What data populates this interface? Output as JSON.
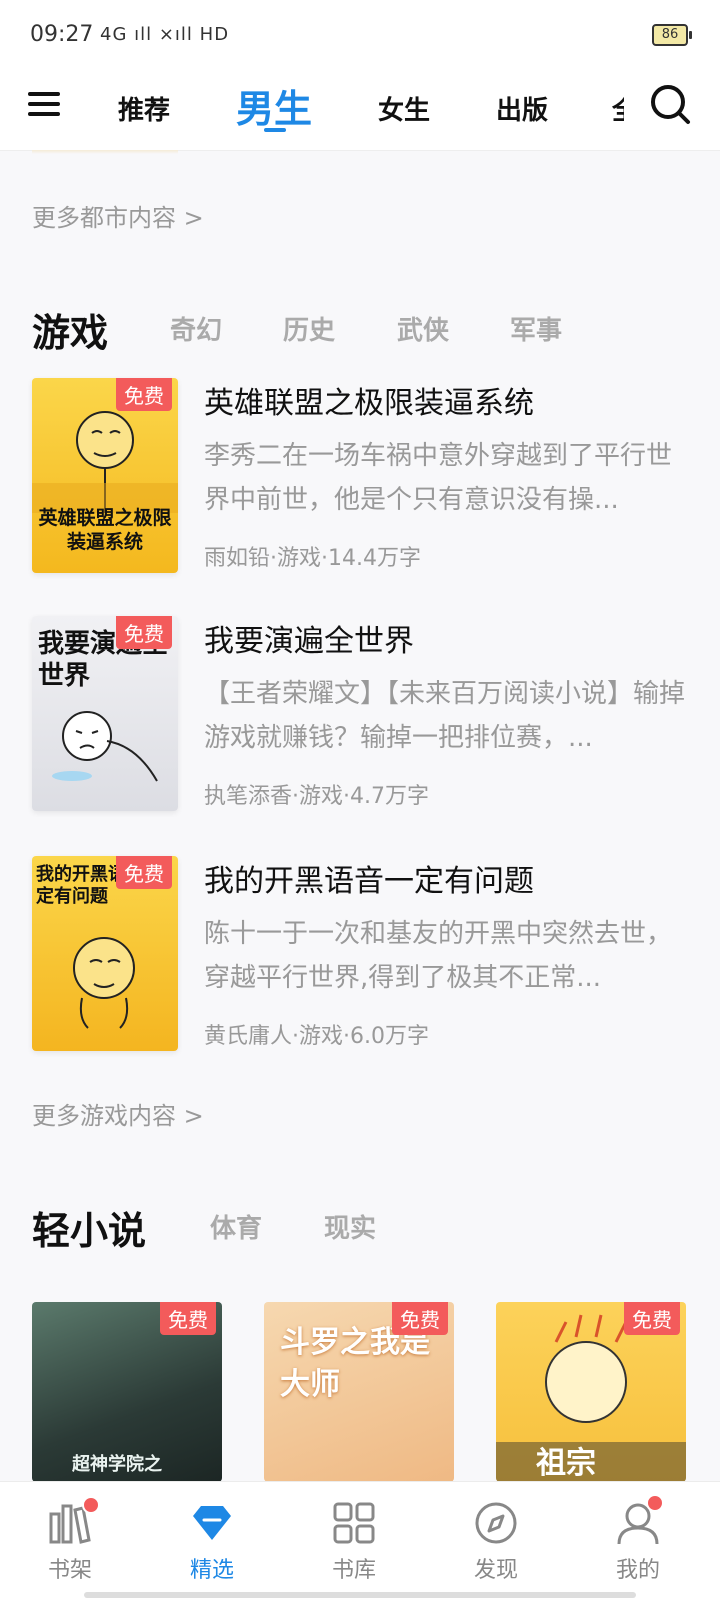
{
  "status": {
    "time": "09:27",
    "signal": "4G ıll ×ıll HD",
    "battery": "86"
  },
  "nav": {
    "tabs": [
      "推荐",
      "男生",
      "女生",
      "出版"
    ],
    "partial": "全"
  },
  "more_urban": "更多都市内容 >",
  "game_section": {
    "title": "游戏",
    "subtabs": [
      "奇幻",
      "历史",
      "武侠",
      "军事"
    ],
    "books": [
      {
        "cover_title": "英雄联盟之极限装逼系统",
        "badge": "免费",
        "title": "英雄联盟之极限装逼系统",
        "desc": "李秀二在一场车祸中意外穿越到了平行世界中前世，他是个只有意识没有操...",
        "meta": "雨如铅·游戏·14.4万字"
      },
      {
        "cover_title": "我要演遍全世界",
        "badge": "免费",
        "title": "我要演遍全世界",
        "desc": "【王者荣耀文】【未来百万阅读小说】输掉游戏就赚钱？输掉一把排位赛，...",
        "meta": "执笔添香·游戏·4.7万字"
      },
      {
        "cover_title": "我的开黑语音一定有问题",
        "badge": "免费",
        "title": "我的开黑语音一定有问题",
        "desc": "陈十一于一次和基友的开黑中突然去世，穿越平行世界,得到了极其不正常...",
        "meta": "黄氏庸人·游戏·6.0万字"
      }
    ]
  },
  "more_game": "更多游戏内容 >",
  "light_section": {
    "title": "轻小说",
    "subtabs": [
      "体育",
      "现实"
    ],
    "books": [
      {
        "badge": "免费",
        "cover_title": "超神学院之"
      },
      {
        "badge": "免费",
        "cover_title": "斗罗之我是大师"
      },
      {
        "badge": "免费",
        "cover_title": "祖宗"
      }
    ]
  },
  "bottom_nav": [
    "书架",
    "精选",
    "书库",
    "发现",
    "我的"
  ],
  "colors": {
    "accent": "#1e88e5",
    "badge": "#f35b5b"
  }
}
